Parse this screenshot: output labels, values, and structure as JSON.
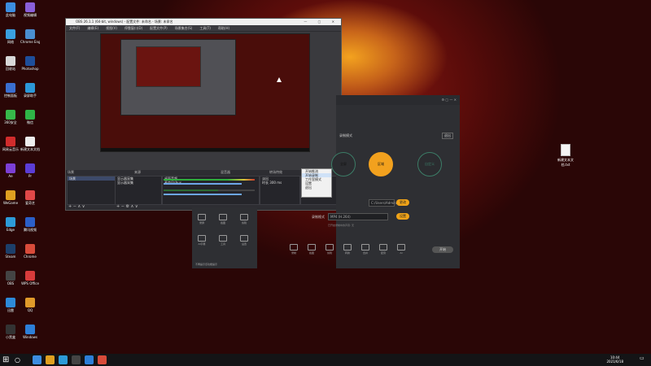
{
  "desktop_icons": [
    {
      "label": "此电脑",
      "color": "#3c8de0"
    },
    {
      "label": "视频编辑",
      "color": "#8a5fd8"
    },
    {
      "label": "网络",
      "color": "#3aa0e0"
    },
    {
      "label": "Chrome Engine",
      "color": "#4a8ed0"
    },
    {
      "label": "回收站",
      "color": "#d8d8d8"
    },
    {
      "label": "Photoshop",
      "color": "#1e4e9a"
    },
    {
      "label": "控制面板",
      "color": "#3a6fd0"
    },
    {
      "label": "录屏助手",
      "color": "#2c98d8"
    },
    {
      "label": "360安全",
      "color": "#37b84a"
    },
    {
      "label": "微信",
      "color": "#2fb547"
    },
    {
      "label": "网易云音乐",
      "color": "#d12c2c"
    },
    {
      "label": "新建文本文档",
      "color": "#eeeeee"
    },
    {
      "label": "Ae",
      "color": "#7c3fd6"
    },
    {
      "label": "Pr",
      "color": "#5b3dd6"
    },
    {
      "label": "WeGame",
      "color": "#e0a020"
    },
    {
      "label": "爱奇艺",
      "color": "#e04848"
    },
    {
      "label": "Edge",
      "color": "#2d9bd8"
    },
    {
      "label": "腾讯视频",
      "color": "#2b5fc8"
    },
    {
      "label": "Steam",
      "color": "#1d3f6a"
    },
    {
      "label": "Chrome",
      "color": "#d84b3a"
    },
    {
      "label": "OBS",
      "color": "#444444"
    },
    {
      "label": "WPS Office",
      "color": "#d83b3b"
    },
    {
      "label": "迅雷",
      "color": "#2d8ad8"
    },
    {
      "label": "QQ",
      "color": "#e09a2a"
    },
    {
      "label": "小黑盒",
      "color": "#333333"
    },
    {
      "label": "Windows",
      "color": "#2d7fd8"
    }
  ],
  "obs": {
    "title": "OBS 26.1.1 (64-bit, windows) - 配置文件: 未命名 - 场景: 未命名",
    "menu": [
      "文件(F)",
      "编辑(E)",
      "视图(V)",
      "停靠窗口(D)",
      "配置文件(P)",
      "场景集合(S)",
      "工具(T)",
      "帮助(H)"
    ],
    "dock_headers": [
      "场景",
      "来源",
      "混音器",
      "转场特效",
      "控件"
    ],
    "scenes": [
      "场景"
    ],
    "sources": [
      "显示器采集",
      "显示器采集"
    ],
    "mixer": [
      {
        "name": "桌面音频",
        "db": "0.0 dB"
      },
      {
        "name": "麦克风/Aux",
        "db": "0.0 dB"
      }
    ],
    "transition": {
      "label": "淡出",
      "duration_label": "时长",
      "duration": "300 ms"
    },
    "controls_menu": [
      "开始推流",
      "开始录制",
      "工作室模式",
      "设置",
      "退出"
    ],
    "controls_highlight": 1
  },
  "recorder": {
    "mode_label": "录制模式",
    "right_btn": "退出",
    "options": [
      "全屏",
      "区域",
      "自定义"
    ],
    "active_option": 1,
    "path_field": "C:/Users/Admin/Videos",
    "path_button": "更改",
    "format_label": "录制格式",
    "format_field": "MP4 (H.264)",
    "format_button": "设置",
    "notice": "已开启录制中的声音: 无",
    "tools": [
      "录制",
      "截图",
      "剪辑",
      "转换",
      "合并",
      "配音",
      "AI"
    ],
    "start_button": "开始"
  },
  "mini_panel": {
    "items": [
      "录屏",
      "截图",
      "剪辑",
      "AI字幕",
      "工具",
      "设置"
    ],
    "footer": "不再提示该功能提示"
  },
  "desktop_file": {
    "label": "新建文本文档.txt"
  },
  "taskbar": {
    "time": "10:44",
    "date": "2021/6/18",
    "apps": [
      {
        "color": "#3c8de0"
      },
      {
        "color": "#e0a020"
      },
      {
        "color": "#2d9bd8"
      },
      {
        "color": "#444444"
      },
      {
        "color": "#2d7fd8"
      },
      {
        "color": "#d84b3a"
      }
    ]
  }
}
